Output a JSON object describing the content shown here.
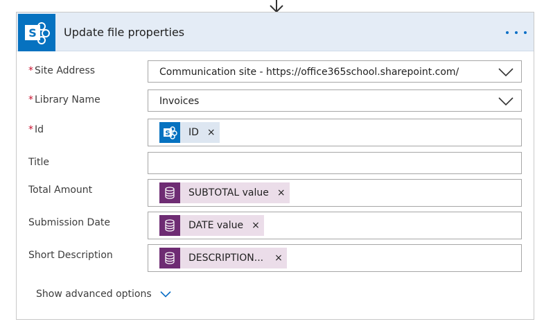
{
  "card": {
    "title": "Update file properties"
  },
  "fields": {
    "site_address": {
      "label": "Site Address",
      "required": "*",
      "value": "Communication site - https://office365school.sharepoint.com/"
    },
    "library_name": {
      "label": "Library Name",
      "required": "*",
      "value": "Invoices"
    },
    "id": {
      "label": "Id",
      "required": "*",
      "token": "ID",
      "remove": "×"
    },
    "title": {
      "label": "Title",
      "value": ""
    },
    "total_amount": {
      "label": "Total Amount",
      "token": "SUBTOTAL value",
      "remove": "×"
    },
    "submission_date": {
      "label": "Submission Date",
      "token": "DATE value",
      "remove": "×"
    },
    "short_description": {
      "label": "Short Description",
      "token": "DESCRIPTION...",
      "remove": "×"
    }
  },
  "advanced": {
    "label": "Show advanced options"
  },
  "icons": {
    "header": "sharepoint-icon",
    "more": "more-icon",
    "dropdown": "chevron-down-icon",
    "id_token": "sharepoint-icon",
    "db_token": "database-icon"
  },
  "colors": {
    "header_bg": "#e4ecf6",
    "sharepoint_blue": "#0672c0",
    "db_purple": "#6e2c73",
    "token_sp_bg": "#dde6f1",
    "token_db_bg": "#ebdde9",
    "required": "#c8102e",
    "accent": "#0b6fc7"
  }
}
